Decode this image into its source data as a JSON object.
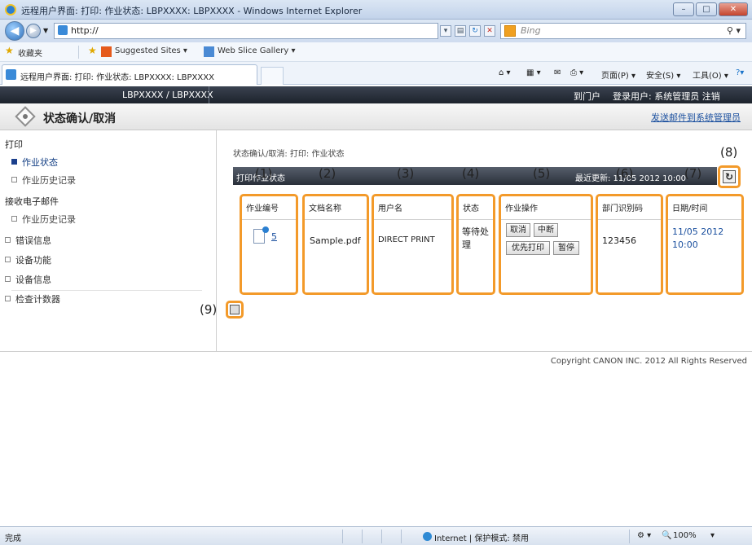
{
  "window": {
    "title": "远程用户界面: 打印: 作业状态: LBPXXXX: LBPXXXX - Windows Internet Explorer"
  },
  "browser": {
    "address": "http://",
    "search_placeholder": "Bing",
    "favorites_label": "收藏夹",
    "suggested_sites": "Suggested Sites ▾",
    "web_slice": "Web Slice Gallery ▾",
    "tab_title": "远程用户界面: 打印: 作业状态: LBPXXXX: LBPXXXX",
    "cmd_page": "页面(P) ▾",
    "cmd_safety": "安全(S) ▾",
    "cmd_tools": "工具(O) ▾",
    "status_done": "完成",
    "status_zone": "Internet | 保护模式: 禁用",
    "status_zoom": "100%"
  },
  "header": {
    "product": "LBPXXXX / LBPXXXX",
    "portal": "到门户",
    "login_user": "登录用户: 系统管理员 注销"
  },
  "subheader": {
    "title": "状态确认/取消",
    "mail_link": "发送邮件到系统管理员"
  },
  "sidebar": {
    "print_head": "打印",
    "job_status": "作业状态",
    "job_history": "作业历史记录",
    "email_head": "接收电子邮件",
    "email_history": "作业历史记录",
    "error_info": "错误信息",
    "device_func": "设备功能",
    "device_info": "设备信息",
    "counter": "检查计数器"
  },
  "content": {
    "breadcrumb": "状态确认/取消: 打印: 作业状态",
    "bar_left": "打印作业状态",
    "bar_right": "最近更新: 11/05 2012 10:00",
    "columns": {
      "job_no": "作业编号",
      "doc_name": "文档名称",
      "user": "用户名",
      "status": "状态",
      "operation": "作业操作",
      "dept_id": "部门识别码",
      "datetime": "日期/时间"
    },
    "row": {
      "job_no": "5",
      "doc_name": "Sample.pdf",
      "user": "DIRECT PRINT",
      "status": "等待处理",
      "dept_id": "123456",
      "datetime": "11/05 2012 10:00"
    },
    "buttons": {
      "cancel": "取消",
      "suspend": "中断",
      "priority": "优先打印",
      "pause": "暂停"
    },
    "callouts": [
      "(1)",
      "(2)",
      "(3)",
      "(4)",
      "(5)",
      "(6)",
      "(7)",
      "(8)",
      "(9)"
    ],
    "copyright": "Copyright CANON INC. 2012 All Rights Reserved"
  },
  "colors": {
    "callout_border": "#f39a2a",
    "header_dark": "#1d232c",
    "link": "#1a4f9e"
  }
}
